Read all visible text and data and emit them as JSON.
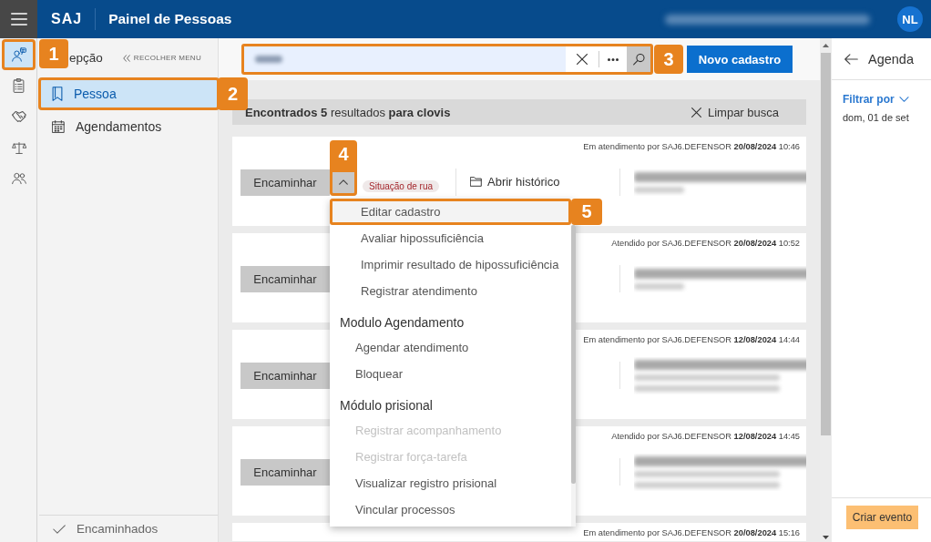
{
  "top_bar": {
    "app_name": "SAJ",
    "title": "Painel de Pessoas",
    "redacted_user": true,
    "avatar": "NL"
  },
  "rail": {
    "items": [
      {
        "kind": "person-chat",
        "selected": true,
        "callout": "1"
      },
      {
        "kind": "clipboard",
        "selected": false
      },
      {
        "kind": "handshake",
        "selected": false
      },
      {
        "kind": "scales",
        "selected": false
      },
      {
        "kind": "people",
        "selected": false
      }
    ]
  },
  "sidebar": {
    "heading": "epção",
    "collapse_label": "RECOLHER MENU",
    "items": [
      {
        "kind": "bookmark",
        "label": "Pessoa",
        "selected": true,
        "callout": "2"
      },
      {
        "kind": "calendar",
        "label": "Agendamentos",
        "selected": false
      }
    ],
    "footer_item": "Encaminhados"
  },
  "search": {
    "redacted_value": true,
    "callout": "3"
  },
  "new_button": "Novo cadastro",
  "results": {
    "summary": "**Encontrados 5** resultados **para clovis**",
    "clear_label": "Limpar busca",
    "cards": [
      {
        "status": "Em atendimento por SAJ6.DEFENSOR **20/08/2024** 10:46",
        "action": "Encaminhar",
        "expanded": true,
        "callout": "4",
        "tag": "Situação de rua",
        "history": "Abrir histórico",
        "redacted_name": true,
        "redacted_extra_lines": false
      },
      {
        "status": "Atendido por SAJ6.DEFENSOR **20/08/2024** 10:52",
        "action": "Encaminhar",
        "redacted_name": true,
        "redacted_extra_lines": false
      },
      {
        "status": "Em atendimento por SAJ6.DEFENSOR **12/08/2024** 14:44",
        "action": "Encaminhar",
        "redacted_name": true,
        "redacted_extra_lines": true
      },
      {
        "status": "Atendido por SAJ6.DEFENSOR **12/08/2024** 14:45",
        "action": "Encaminhar",
        "redacted_name": true,
        "redacted_extra_lines": true
      },
      {
        "status": "Em atendimento por SAJ6.DEFENSOR **20/08/2024** 15:16"
      }
    ]
  },
  "menu": {
    "items": [
      {
        "label": "Editar cadastro",
        "highlighted": true,
        "disabled": false,
        "callout": "5"
      },
      {
        "label": "Avaliar hipossuficiência",
        "highlighted": false,
        "disabled": false
      },
      {
        "label": "Imprimir resultado de hipossuficiência",
        "highlighted": false,
        "disabled": false
      },
      {
        "label": "Registrar atendimento",
        "highlighted": false,
        "disabled": false
      }
    ],
    "sections": [
      {
        "heading": "Modulo Agendamento",
        "items": [
          {
            "label": "Agendar atendimento",
            "highlighted": false,
            "disabled": false
          },
          {
            "label": "Bloquear",
            "highlighted": false,
            "disabled": false
          }
        ]
      },
      {
        "heading": "Módulo prisional",
        "items": [
          {
            "label": "Registrar acompanhamento",
            "highlighted": false,
            "disabled": true
          },
          {
            "label": "Registrar força-tarefa",
            "highlighted": false,
            "disabled": true
          },
          {
            "label": "Visualizar registro prisional",
            "highlighted": false,
            "disabled": false
          },
          {
            "label": "Vincular processos",
            "highlighted": false,
            "disabled": false
          }
        ]
      }
    ]
  },
  "agenda": {
    "title": "Agenda",
    "filter_label": "Filtrar por",
    "date": "dom, 01 de set",
    "create_button": "Criar evento"
  }
}
